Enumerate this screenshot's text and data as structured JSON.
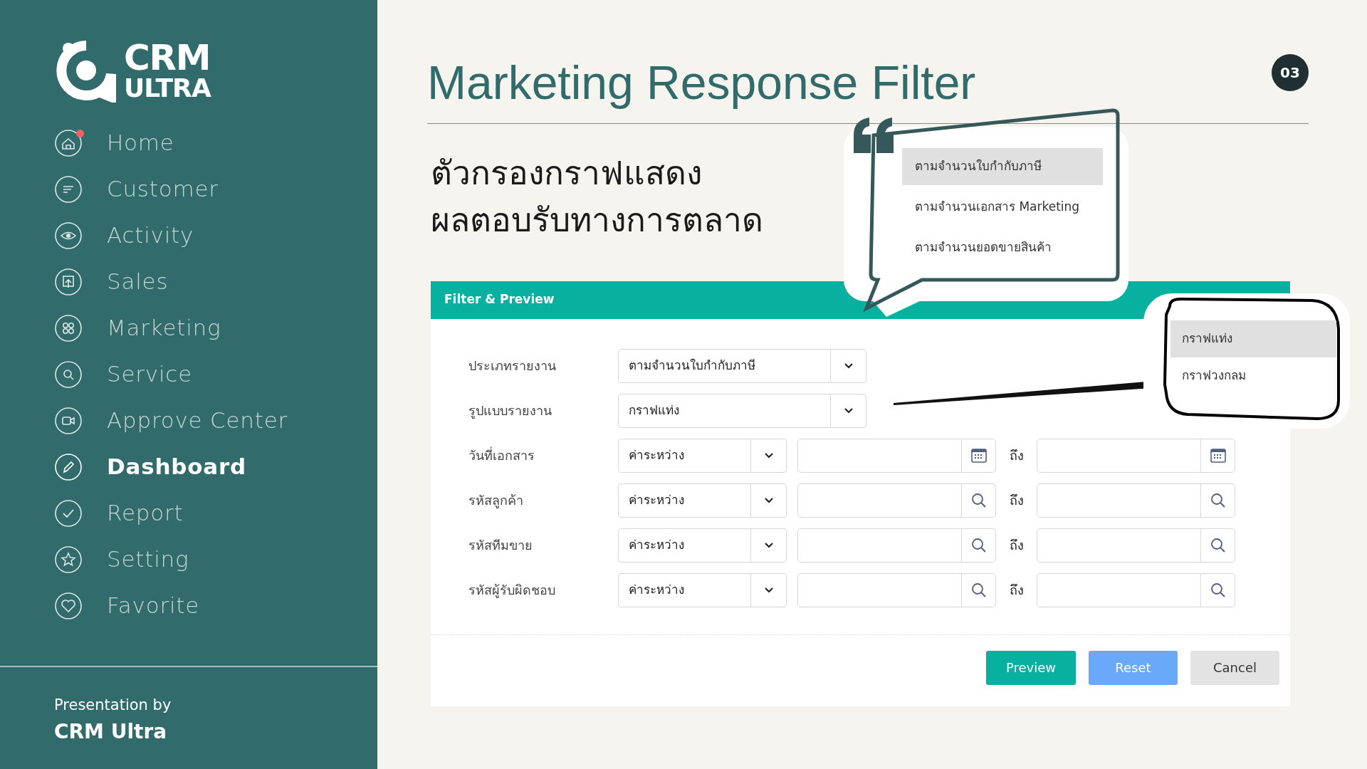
{
  "logo": {
    "line_1": "CRM",
    "line_2": "ULTRA"
  },
  "sidebar": {
    "items": [
      {
        "label": "Home",
        "selected": false,
        "notification": true
      },
      {
        "label": "Customer",
        "selected": false,
        "notification": false
      },
      {
        "label": "Activity",
        "selected": false,
        "notification": false
      },
      {
        "label": "Sales",
        "selected": false,
        "notification": false
      },
      {
        "label": "Marketing",
        "selected": false,
        "notification": false
      },
      {
        "label": "Service",
        "selected": false,
        "notification": false
      },
      {
        "label": "Approve Center",
        "selected": false,
        "notification": false
      },
      {
        "label": "Dashboard",
        "selected": true,
        "notification": false
      },
      {
        "label": "Report",
        "selected": false,
        "notification": false
      },
      {
        "label": "Setting",
        "selected": false,
        "notification": false
      },
      {
        "label": "Favorite",
        "selected": false,
        "notification": false
      }
    ],
    "footer": {
      "caption": "Presentation by",
      "name": "CRM Ultra"
    }
  },
  "page": {
    "title": "Marketing Response Filter",
    "page_number": "03",
    "subtitle_lines": [
      "ตัวกรองกราฟแสดง",
      "ผลตอบรับทางการตลาด"
    ]
  },
  "filter_panel": {
    "title": "Filter & Preview",
    "rows": [
      {
        "kind": "single",
        "label": "ประเภทรายงาน",
        "value": "ตามจำนวนใบกำกับภาษี"
      },
      {
        "kind": "single",
        "label": "รูปแบบรายงาน",
        "value": "กราฟแท่ง"
      },
      {
        "kind": "date_range",
        "label": "วันที่เอกสาร",
        "operator": "ค่าระหว่าง",
        "separator": "ถึง"
      },
      {
        "kind": "lookup_range",
        "label": "รหัสลูกค้า",
        "operator": "ค่าระหว่าง",
        "separator": "ถึง"
      },
      {
        "kind": "lookup_range",
        "label": "รหัสทีมขาย",
        "operator": "ค่าระหว่าง",
        "separator": "ถึง"
      },
      {
        "kind": "lookup_range",
        "label": "รหัสผู้รับผิดชอบ",
        "operator": "ค่าระหว่าง",
        "separator": "ถึง"
      }
    ],
    "buttons": [
      {
        "label": "Preview",
        "kind": "primary"
      },
      {
        "label": "Reset",
        "kind": "secondary"
      },
      {
        "label": "Cancel",
        "kind": "neutral"
      }
    ]
  },
  "callouts": [
    {
      "options": [
        {
          "label": "ตามจำนวนใบกำกับภาษี",
          "selected": true
        },
        {
          "label": "ตามจำนวนเอกสาร Marketing",
          "selected": false
        },
        {
          "label": "ตามจำนวนยอดขายสินค้า",
          "selected": false
        }
      ]
    },
    {
      "options": [
        {
          "label": "กราฟแท่ง",
          "selected": true
        },
        {
          "label": "กราฟวงกลม",
          "selected": false
        }
      ]
    }
  ]
}
